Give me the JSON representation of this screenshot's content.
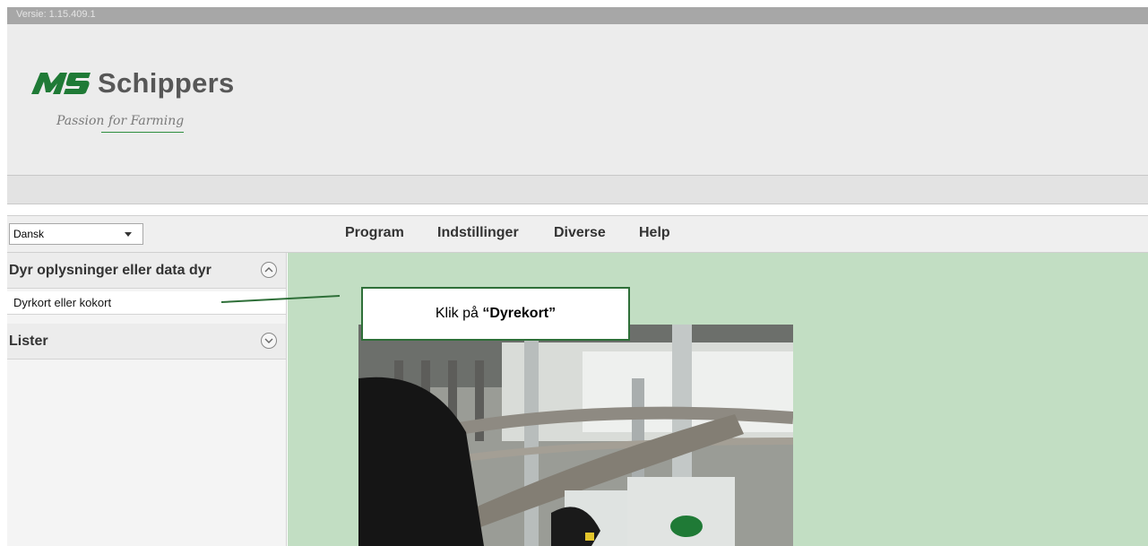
{
  "version_bar": {
    "text": "Versie: 1.15.409.1"
  },
  "logo": {
    "brand_text": "Schippers",
    "tagline": "Passion for Farming"
  },
  "menubar": {
    "language_selected": "Dansk",
    "items": [
      {
        "label": "Program"
      },
      {
        "label": "Indstillinger"
      },
      {
        "label": "Diverse"
      },
      {
        "label": "Help"
      }
    ]
  },
  "sidebar": {
    "sections": [
      {
        "title": "Dyr oplysninger eller data dyr",
        "state": "expanded",
        "items": [
          "Dyrkort eller kokort"
        ]
      },
      {
        "title": "Lister",
        "state": "collapsed",
        "items": []
      }
    ]
  },
  "callout": {
    "prefix": "Klik på ",
    "emphasis": "“Dyrekort”"
  },
  "colors": {
    "brand_green": "#1f7a36",
    "content_bg": "#c2dec3",
    "callout_border": "#2e6f38"
  }
}
